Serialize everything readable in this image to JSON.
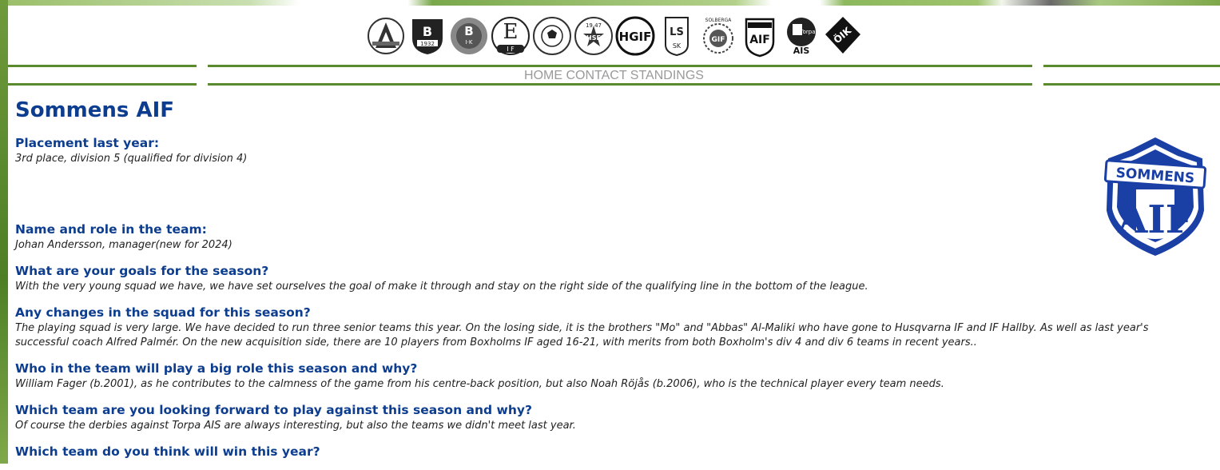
{
  "nav": {
    "items": [
      "HOME",
      "CONTACT",
      "STANDINGS"
    ]
  },
  "club_logos": [
    {
      "name": "club-logo-1",
      "text": "A",
      "style": "circle-letter"
    },
    {
      "name": "club-logo-2",
      "text": "1932",
      "style": "shield"
    },
    {
      "name": "club-logo-3",
      "text": "B·I·K",
      "style": "circle-letter"
    },
    {
      "name": "club-logo-4",
      "text": "E IF",
      "style": "circle-letter"
    },
    {
      "name": "club-logo-5",
      "text": "",
      "style": "football"
    },
    {
      "name": "club-logo-6",
      "text": "HSF 1947",
      "style": "star"
    },
    {
      "name": "club-logo-7",
      "text": "HGIF",
      "style": "circle-letter"
    },
    {
      "name": "club-logo-8",
      "text": "LS SK",
      "style": "shield"
    },
    {
      "name": "club-logo-9",
      "text": "SOLBERGA GIF",
      "style": "wreath"
    },
    {
      "name": "club-logo-10",
      "text": "SOMMENS AIF",
      "style": "shield"
    },
    {
      "name": "club-logo-11",
      "text": "TORPA AIS",
      "style": "circle-letter"
    },
    {
      "name": "club-logo-12",
      "text": "ÖIK",
      "style": "diamond"
    }
  ],
  "page": {
    "title": "Sommens AIF",
    "crest_text_top": "SOMMENS",
    "crest_text_bottom": "AIF"
  },
  "qa": [
    {
      "q": "Placement last year:",
      "a": "3rd place, division 5 (qualified for division 4)"
    },
    {
      "q": "Name and role in the team:",
      "a": "Johan Andersson, manager(new for 2024)"
    },
    {
      "q": "What are your goals for the season?",
      "a": "With the very young squad we have, we have set ourselves the goal of make it through and stay on the right side of the qualifying line in the bottom of the league."
    },
    {
      "q": "Any changes in the squad for this season?",
      "a": "The playing squad is very large. We have decided to run three senior teams this year. On the losing side, it is the brothers \"Mo\" and \"Abbas\" Al-Maliki who have gone to Husqvarna IF and IF Hallby. As well as last year's successful coach Alfred Palmér. On the new acquisition side, there are 10 players from Boxholms IF aged 16-21, with merits from both Boxholm's div 4 and div 6 teams in recent years.."
    },
    {
      "q": "Who in the team will play a big role this season and why?",
      "a": "William Fager (b.2001), as he contributes to the calmness of the game from his centre-back position, but also Noah Röjås (b.2006), who is the technical player every team needs."
    },
    {
      "q": "Which team are you looking forward to play against this season and why?",
      "a": "Of course the derbies against Torpa AIS are always interesting, but also the teams we didn't meet last year."
    },
    {
      "q": "Which team do you think will win this year?",
      "a": ""
    }
  ],
  "colors": {
    "heading": "#0d3d8f",
    "green_line": "#5a8a2e",
    "nav_text": "#9a9a9a"
  }
}
